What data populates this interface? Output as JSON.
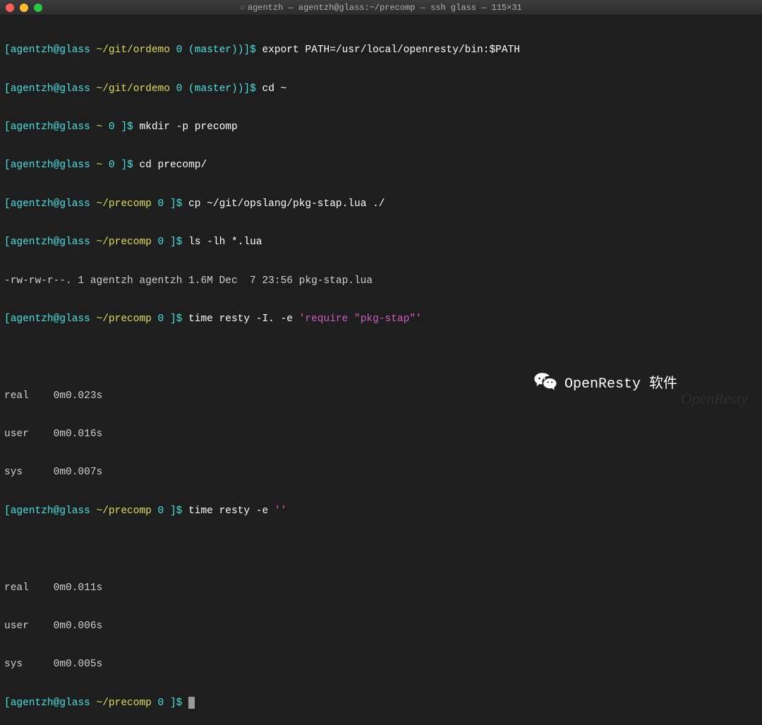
{
  "window": {
    "title": "agentzh — agentzh@glass:~/precomp — ssh glass — 115×31"
  },
  "colors": {
    "bracket": "#48e1e1",
    "path": "#dede5a",
    "prompt": "#ffffff",
    "command_variant": "#ce5dc4"
  },
  "prompts": {
    "p1_user": "agentzh@glass",
    "p1_path": " ~/git/ordemo",
    "p1_num": " 0",
    "p1_branch": " (master)",
    "p2_user": "agentzh@glass",
    "p2_path": " ~/git/ordemo",
    "p2_num": " 0",
    "p2_branch": " (master)",
    "p3_user": "agentzh@glass",
    "p3_path": " ~",
    "p3_num": " 0",
    "p4_user": "agentzh@glass",
    "p4_path": " ~",
    "p4_num": " 0",
    "p5_user": "agentzh@glass",
    "p5_path": " ~/precomp",
    "p5_num": " 0",
    "p6_user": "agentzh@glass",
    "p6_path": " ~/precomp",
    "p6_num": " 0",
    "p7_user": "agentzh@glass",
    "p7_path": " ~/precomp",
    "p7_num": " 0",
    "p8_user": "agentzh@glass",
    "p8_path": " ~/precomp",
    "p8_num": " 0",
    "p9_user": "agentzh@glass",
    "p9_path": " ~/precomp",
    "p9_num": " 0"
  },
  "delims": {
    "open": "[",
    "close_dollar": " ]$ ",
    "close_paren_dollar": ")]$ "
  },
  "commands": {
    "c1": "export PATH=/usr/local/openresty/bin:$PATH",
    "c2": "cd ~",
    "c3": "mkdir -p precomp",
    "c4": "cd precomp/",
    "c5": "cp ~/git/opslang/pkg-stap.lua ./",
    "c6": "ls -lh *.lua",
    "c7_a": "time resty -I. -e ",
    "c7_b": "'require \"pkg-stap\"'",
    "c8_a": "time resty -e ",
    "c8_b": "''"
  },
  "output": {
    "ls": "-rw-rw-r--. 1 agentzh agentzh 1.6M Dec  7 23:56 pkg-stap.lua",
    "blank": " ",
    "t1_real": "real    0m0.023s",
    "t1_user": "user    0m0.016s",
    "t1_sys": "sys     0m0.007s",
    "t2_real": "real    0m0.011s",
    "t2_user": "user    0m0.006s",
    "t2_sys": "sys     0m0.005s"
  },
  "watermark": {
    "wechat_label": "OpenResty 软件",
    "logo": "OpenResty"
  }
}
